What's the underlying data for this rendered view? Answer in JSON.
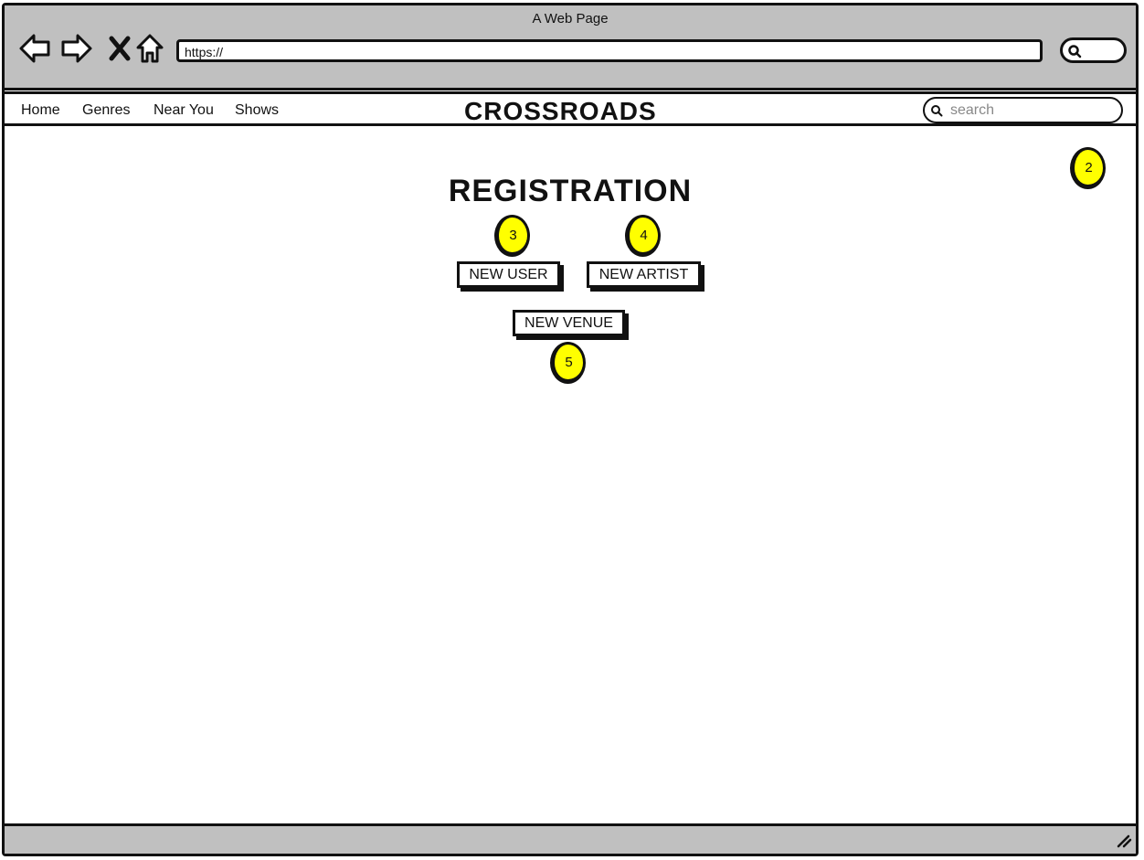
{
  "browser": {
    "title": "A Web Page",
    "url": "https://",
    "icons": [
      "back-arrow-icon",
      "forward-arrow-icon",
      "close-icon",
      "home-icon",
      "search-icon",
      "resize-grip-icon"
    ]
  },
  "site": {
    "nav_items": [
      {
        "label": "Home"
      },
      {
        "label": "Genres"
      },
      {
        "label": "Near You"
      },
      {
        "label": "Shows"
      }
    ],
    "brand": "CROSSROADS",
    "search_placeholder": "search"
  },
  "main": {
    "heading": "REGISTRATION",
    "buttons": {
      "new_user": "NEW USER",
      "new_artist": "NEW ARTIST",
      "new_venue": "NEW VENUE"
    }
  },
  "annotations": [
    "2",
    "3",
    "4",
    "5"
  ],
  "colors": {
    "chrome": "#c0c0c0",
    "annotation": "#ffff00",
    "ink": "#111111"
  }
}
